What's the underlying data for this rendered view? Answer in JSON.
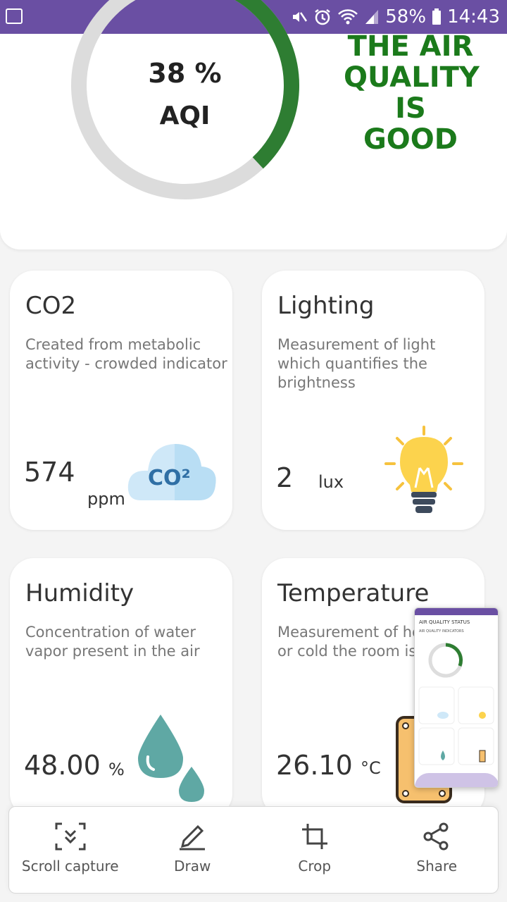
{
  "status_bar": {
    "battery": "58%",
    "time": "14:43",
    "icons": [
      "image-icon",
      "mute-icon",
      "alarm-icon",
      "wifi-icon",
      "signal-icon",
      "battery-icon"
    ]
  },
  "aqi": {
    "value": "38 %",
    "label": "AQI",
    "percent": 38,
    "status_text": "THE AIR QUALITY IS GOOD",
    "ring_color": "#2e7d32",
    "track_color": "#dcdcdc",
    "status_color": "#1b7a1b"
  },
  "cards": [
    {
      "title": "CO2",
      "description": "Created from metabolic activity - crowded indicator",
      "value": "574",
      "unit": "ppm",
      "icon": "co2-cloud-icon",
      "icon_text": "CO²"
    },
    {
      "title": "Lighting",
      "description": "Measurement of light which quantifies the brightness",
      "value": "2",
      "unit": "lux",
      "icon": "light-bulb-icon"
    },
    {
      "title": "Humidity",
      "description": "Concentration of water vapor present in the air",
      "value": "48.00",
      "unit": "%",
      "icon": "water-drops-icon"
    },
    {
      "title": "Temperature",
      "description": "Measurement of how hot or cold the room is",
      "value": "26.10",
      "unit": "°C",
      "icon": "thermometer-icon"
    }
  ],
  "toolbar": {
    "items": [
      {
        "label": "Scroll capture",
        "icon": "scroll-capture-icon"
      },
      {
        "label": "Draw",
        "icon": "pencil-icon"
      },
      {
        "label": "Crop",
        "icon": "crop-icon"
      },
      {
        "label": "Share",
        "icon": "share-icon"
      }
    ]
  },
  "thumbnail": {
    "header": "AIR QUALITY STATUS",
    "subheader": "AIR QUALITY INDICATORS"
  }
}
